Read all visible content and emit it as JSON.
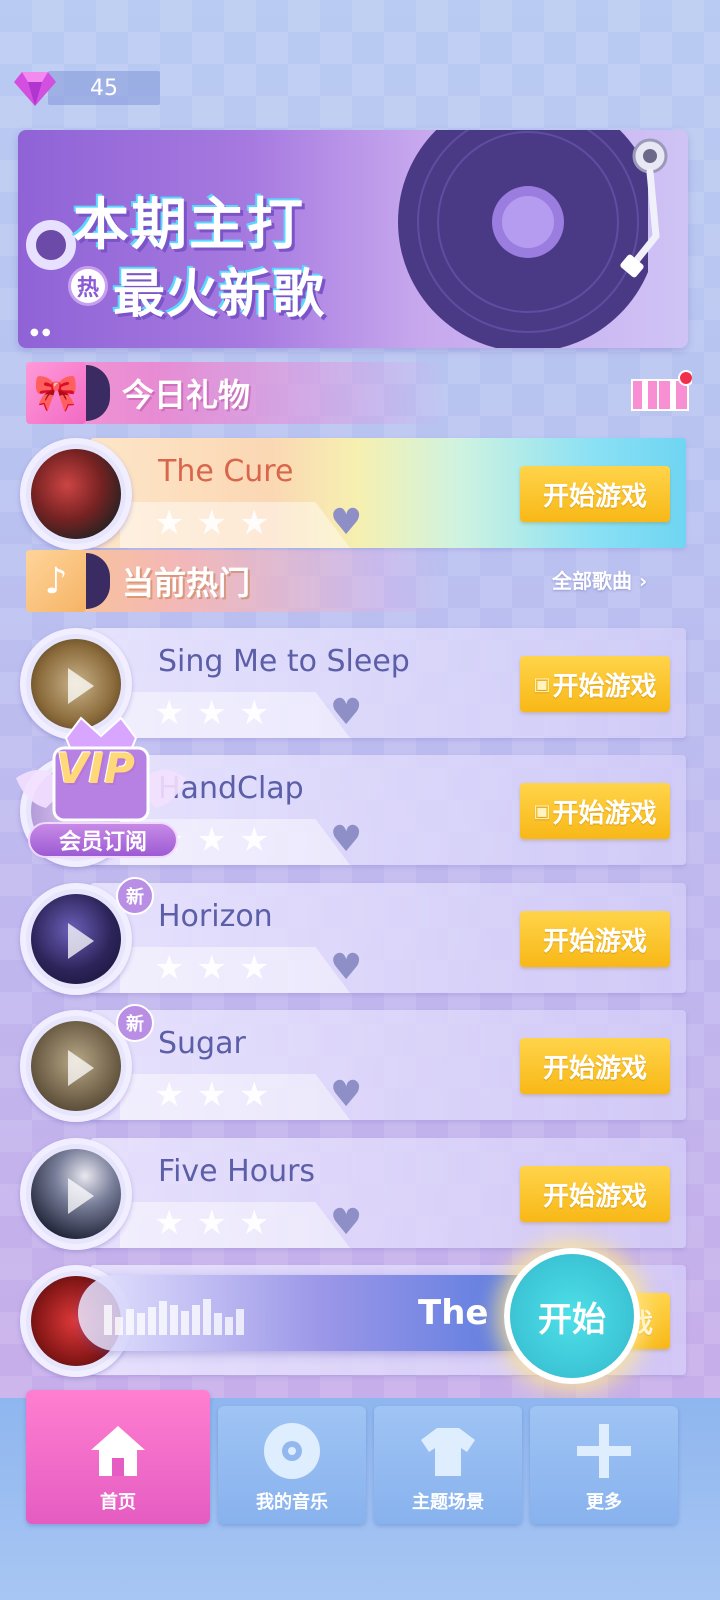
{
  "header": {
    "gem_count": "45"
  },
  "banner": {
    "title": "本期主打",
    "subtitle": "最火新歌",
    "hot_badge": "热"
  },
  "sections": {
    "gift": {
      "label": "今日礼物"
    },
    "hot": {
      "label": "当前热门",
      "all_songs": "全部歌曲"
    }
  },
  "featured_song": {
    "title": "The Cure",
    "button": "开始游戏"
  },
  "songs": [
    {
      "title": "Sing Me to Sleep",
      "button": "开始游戏",
      "video": true,
      "new": false
    },
    {
      "title": "HandClap",
      "button": "开始游戏",
      "video": true,
      "new": false
    },
    {
      "title": "Horizon",
      "button": "开始游戏",
      "video": false,
      "new": true,
      "new_label": "新"
    },
    {
      "title": "Sugar",
      "button": "开始游戏",
      "video": false,
      "new": true,
      "new_label": "新"
    },
    {
      "title": "Five Hours",
      "button": "开始游戏",
      "video": false,
      "new": false
    }
  ],
  "partial_row": {
    "button_tail": "戏"
  },
  "vip": {
    "text": "VIP",
    "label": "会员订阅"
  },
  "mini_player": {
    "title": "The",
    "play_label": "开始"
  },
  "bottom_nav": [
    {
      "label": "首页",
      "icon": "home-icon",
      "active": true
    },
    {
      "label": "我的音乐",
      "icon": "disc-icon",
      "active": false
    },
    {
      "label": "主题场景",
      "icon": "tshirt-icon",
      "active": false
    },
    {
      "label": "更多",
      "icon": "plus-icon",
      "active": false
    }
  ],
  "colors": {
    "accent_pink": "#e55cc2",
    "button_yellow": "#f8b817",
    "play_cyan": "#3ec8d8"
  }
}
